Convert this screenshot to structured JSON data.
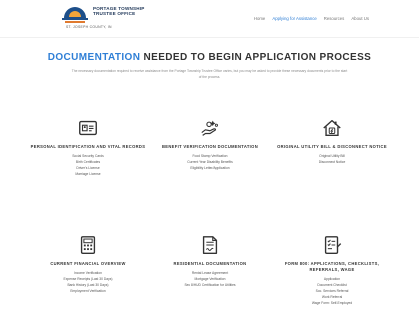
{
  "header": {
    "logo": {
      "line1": "PORTAGE TOWNSHIP",
      "line2": "TRUSTEE OFFICE",
      "tagline": "ST. JOSEPH COUNTY, IN"
    },
    "nav": [
      {
        "label": "Home",
        "active": false
      },
      {
        "label": "Applying for Assistance",
        "active": true
      },
      {
        "label": "Resources",
        "active": false
      },
      {
        "label": "About Us",
        "active": false
      }
    ]
  },
  "page": {
    "title_highlight": "DOCUMENTATION",
    "title_rest": " NEEDED TO BEGIN APPLICATION PROCESS",
    "intro": "The necessary documentation required to receive assistance from the Portage Township Trustee Office varies, but you may be asked to provide these necessary documents prior to the start of the process."
  },
  "cards": [
    {
      "icon": "id-card-icon",
      "title": "Personal Identification and Vital Records",
      "items": [
        "Social Security Cards",
        "Birth Certificates",
        "Driver's License",
        "Marriage License"
      ]
    },
    {
      "icon": "hand-benefits-icon",
      "title": "Benefit Verification Documentation",
      "items": [
        "Food Stamp Verification",
        "Current Year Disability Benefits",
        "Eligibility Letter/Application"
      ]
    },
    {
      "icon": "house-bill-icon",
      "title": "Original Utility Bill & Disconnect Notice",
      "items": [
        "Original Utility Bill",
        "Disconnect Notice"
      ]
    },
    {
      "icon": "calculator-doc-icon",
      "title": "Current Financial Overview",
      "items": [
        "Income Verification",
        "Expense Receipts (Last 30 Days)",
        "Bank History (Last 30 Days)",
        "Employment Verification"
      ]
    },
    {
      "icon": "signed-doc-icon",
      "title": "Residential Documentation",
      "items": [
        "Rental Lease Agreement",
        "Mortgage Verification",
        "Sec 8/HUD Certification for Utilities"
      ]
    },
    {
      "icon": "checklist-doc-icon",
      "title": "Form 800: Applications, Checklists, Referrals, Wage",
      "items": [
        "Application",
        "Document Checklist",
        "Soc. Services Referral",
        "Work Referral",
        "Wage Form: Self-Employed"
      ]
    }
  ],
  "colors": {
    "accent": "#2f7fd6",
    "heading": "#333333",
    "logo_navy": "#1d4f8a",
    "logo_orange": "#e07a2f"
  }
}
